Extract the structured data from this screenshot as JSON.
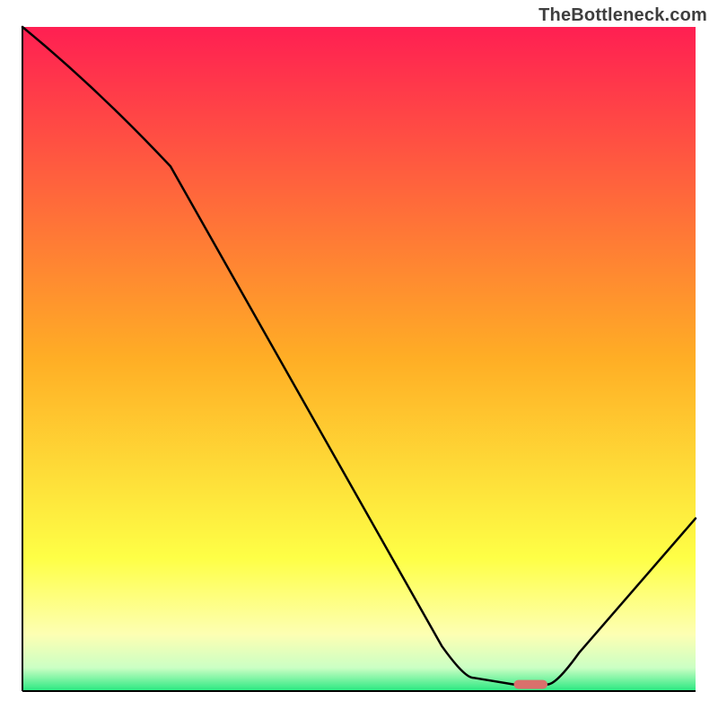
{
  "watermark": "TheBottleneck.com",
  "chart_data": {
    "type": "line",
    "title": "",
    "xlabel": "",
    "ylabel": "",
    "xlim": [
      0,
      100
    ],
    "ylim": [
      0,
      100
    ],
    "grid": false,
    "series": [
      {
        "name": "bottleneck-curve",
        "x": [
          0,
          22,
          67,
          73,
          78,
          100
        ],
        "values": [
          100,
          79,
          2,
          1,
          1,
          26
        ]
      }
    ],
    "marker": {
      "name": "optimal-range",
      "x_start": 73,
      "x_end": 78,
      "y": 1,
      "color": "#d9706c"
    },
    "background_gradient": {
      "stops": [
        {
          "offset": 0.0,
          "color": "#ff1f52"
        },
        {
          "offset": 0.5,
          "color": "#ffae25"
        },
        {
          "offset": 0.8,
          "color": "#feff46"
        },
        {
          "offset": 0.915,
          "color": "#fdffb3"
        },
        {
          "offset": 0.965,
          "color": "#cbffc4"
        },
        {
          "offset": 1.0,
          "color": "#27e880"
        }
      ]
    },
    "axis_line_color": "#000000",
    "curve_color": "#000000"
  }
}
